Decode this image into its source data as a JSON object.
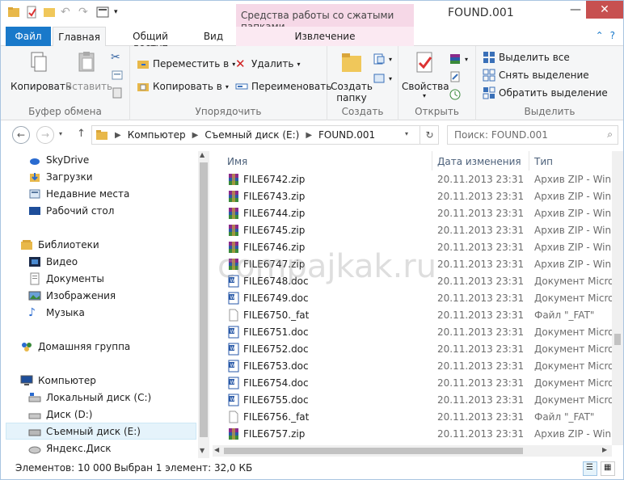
{
  "window": {
    "title": "FOUND.001",
    "context_group": "Средства работы со сжатыми папками"
  },
  "tabs": {
    "file": "Файл",
    "home": "Главная",
    "share": "Общий доступ",
    "view": "Вид",
    "extract": "Извлечение"
  },
  "ribbon": {
    "clipboard": {
      "label": "Буфер обмена",
      "copy": "Копировать",
      "paste": "Вставить"
    },
    "organize": {
      "label": "Упорядочить",
      "move_to": "Переместить в",
      "copy_to": "Копировать в",
      "delete": "Удалить",
      "rename": "Переименовать"
    },
    "create": {
      "label": "Создать",
      "new_folder_line1": "Создать",
      "new_folder_line2": "папку"
    },
    "open": {
      "label": "Открыть",
      "properties": "Свойства"
    },
    "select": {
      "label": "Выделить",
      "select_all": "Выделить все",
      "select_none": "Снять выделение",
      "invert": "Обратить выделение"
    }
  },
  "address": {
    "crumbs": [
      "Компьютер",
      "Съемный диск (E:)",
      "FOUND.001"
    ],
    "search_placeholder": "Поиск: FOUND.001"
  },
  "nav": {
    "items": [
      {
        "label": "SkyDrive",
        "icon": "cloud-icon"
      },
      {
        "label": "Загрузки",
        "icon": "downloads-icon"
      },
      {
        "label": "Недавние места",
        "icon": "recent-places-icon"
      },
      {
        "label": "Рабочий стол",
        "icon": "desktop-icon"
      },
      {
        "label": "Библиотеки",
        "icon": "libraries-icon"
      },
      {
        "label": "Видео",
        "icon": "video-icon"
      },
      {
        "label": "Документы",
        "icon": "documents-icon"
      },
      {
        "label": "Изображения",
        "icon": "pictures-icon"
      },
      {
        "label": "Музыка",
        "icon": "music-icon"
      },
      {
        "label": "Домашняя группа",
        "icon": "homegroup-icon"
      },
      {
        "label": "Компьютер",
        "icon": "computer-icon"
      },
      {
        "label": "Локальный диск (C:)",
        "icon": "drive-icon"
      },
      {
        "label": "Диск (D:)",
        "icon": "drive-icon"
      },
      {
        "label": "Съемный диск (E:)",
        "icon": "removable-drive-icon"
      },
      {
        "label": "Яндекс.Диск",
        "icon": "yandex-disk-icon"
      }
    ]
  },
  "columns": {
    "name": "Имя",
    "date": "Дата изменения",
    "type": "Тип"
  },
  "files": [
    {
      "name": "FILE6742.zip",
      "date": "20.11.2013 23:31",
      "type": "Архив ZIP - WinRAR",
      "kind": "zip"
    },
    {
      "name": "FILE6743.zip",
      "date": "20.11.2013 23:31",
      "type": "Архив ZIP - WinRAR",
      "kind": "zip"
    },
    {
      "name": "FILE6744.zip",
      "date": "20.11.2013 23:31",
      "type": "Архив ZIP - WinRAR",
      "kind": "zip"
    },
    {
      "name": "FILE6745.zip",
      "date": "20.11.2013 23:31",
      "type": "Архив ZIP - WinRAR",
      "kind": "zip"
    },
    {
      "name": "FILE6746.zip",
      "date": "20.11.2013 23:31",
      "type": "Архив ZIP - WinRAR",
      "kind": "zip"
    },
    {
      "name": "FILE6747.zip",
      "date": "20.11.2013 23:31",
      "type": "Архив ZIP - WinRAR",
      "kind": "zip"
    },
    {
      "name": "FILE6748.doc",
      "date": "20.11.2013 23:31",
      "type": "Документ Microsoft",
      "kind": "doc"
    },
    {
      "name": "FILE6749.doc",
      "date": "20.11.2013 23:31",
      "type": "Документ Microsoft",
      "kind": "doc"
    },
    {
      "name": "FILE6750._fat",
      "date": "20.11.2013 23:31",
      "type": "Файл \"_FAT\"",
      "kind": "blank"
    },
    {
      "name": "FILE6751.doc",
      "date": "20.11.2013 23:31",
      "type": "Документ Microsoft",
      "kind": "doc"
    },
    {
      "name": "FILE6752.doc",
      "date": "20.11.2013 23:31",
      "type": "Документ Microsoft",
      "kind": "doc"
    },
    {
      "name": "FILE6753.doc",
      "date": "20.11.2013 23:31",
      "type": "Документ Microsoft",
      "kind": "doc"
    },
    {
      "name": "FILE6754.doc",
      "date": "20.11.2013 23:31",
      "type": "Документ Microsoft",
      "kind": "doc"
    },
    {
      "name": "FILE6755.doc",
      "date": "20.11.2013 23:31",
      "type": "Документ Microsoft",
      "kind": "doc"
    },
    {
      "name": "FILE6756._fat",
      "date": "20.11.2013 23:31",
      "type": "Файл \"_FAT\"",
      "kind": "blank"
    },
    {
      "name": "FILE6757.zip",
      "date": "20.11.2013 23:31",
      "type": "Архив ZIP - WinRAR",
      "kind": "zip"
    }
  ],
  "status": {
    "count": "Элементов: 10 000",
    "selected": "Выбран 1 элемент: 32,0 КБ"
  },
  "watermark": "compajkak.ru",
  "colors": {
    "file_tab": "#1979ca",
    "context_tab": "#f6d8e7",
    "close_button": "#c75050"
  }
}
